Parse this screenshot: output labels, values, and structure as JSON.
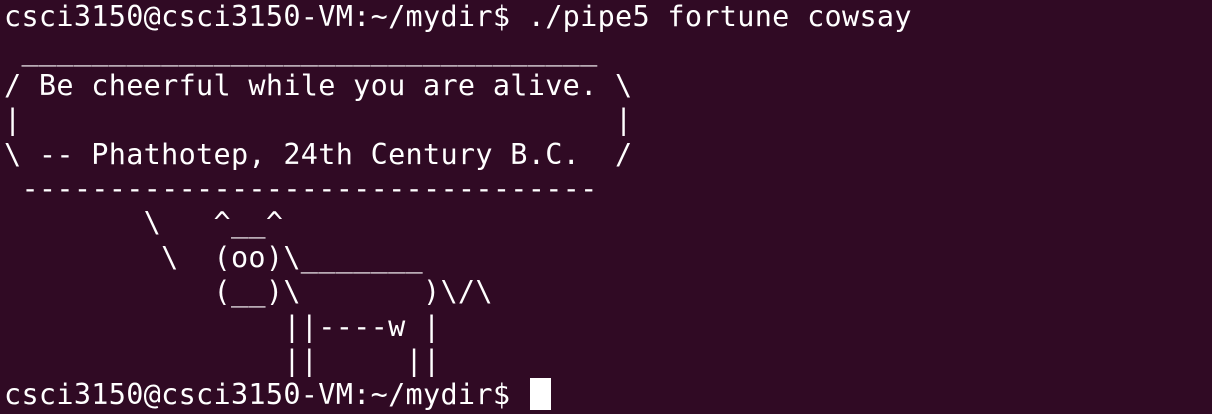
{
  "terminal": {
    "theme": {
      "background": "#300a24",
      "foreground": "#ffffff"
    },
    "lines": [
      "csci3150@csci3150-VM:~/mydir$ ./pipe5 fortune cowsay",
      " _________________________________",
      "/ Be cheerful while you are alive. \\",
      "|                                  |",
      "\\ -- Phathotep, 24th Century B.C.  /",
      " ---------------------------------",
      "        \\   ^__^",
      "         \\  (oo)\\_______",
      "            (__)\\       )\\/\\",
      "                ||----w |",
      "                ||     ||"
    ],
    "prompt": "csci3150@csci3150-VM:~/mydir$ "
  }
}
